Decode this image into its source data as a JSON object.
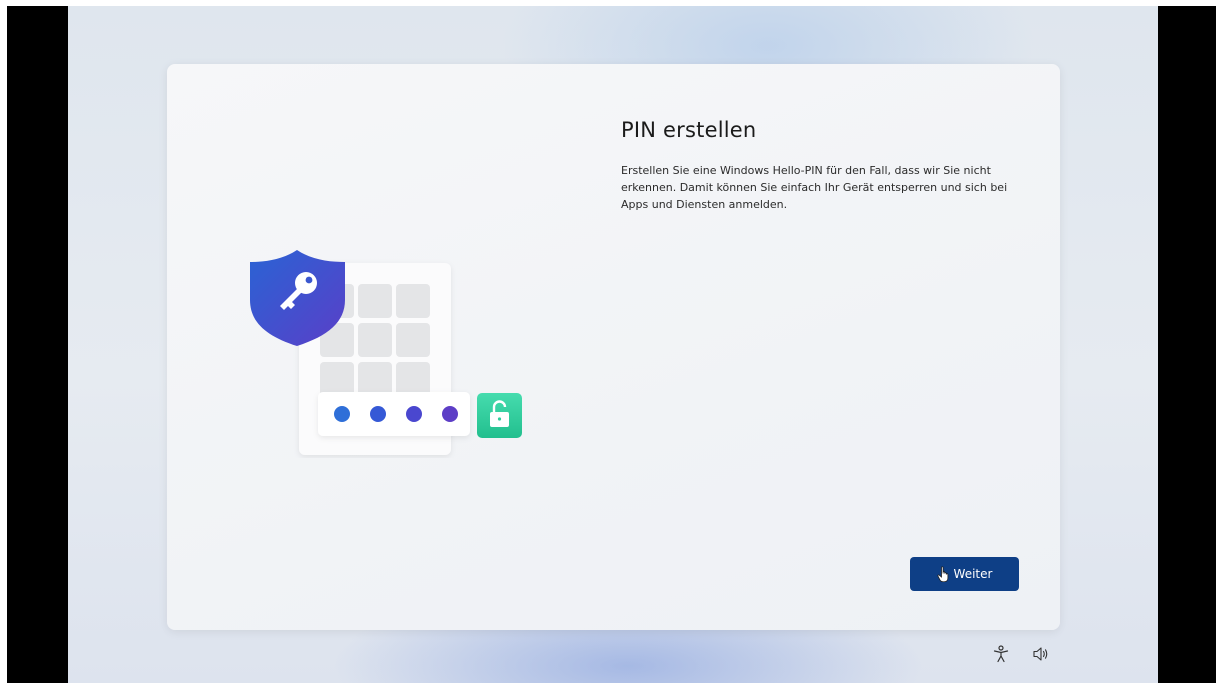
{
  "page": {
    "title": "PIN erstellen",
    "description": "Erstellen Sie eine Windows Hello-PIN für den Fall, dass wir Sie nicht erkennen. Damit können Sie einfach Ihr Gerät entsperren und sich bei Apps und Diensten anmelden."
  },
  "buttons": {
    "next_label": "Weiter"
  },
  "illustration": {
    "icons": [
      "shield-key-icon",
      "keypad-icon",
      "pin-dots-icon",
      "unlock-icon"
    ],
    "pin_dot_colors": [
      "#2f6fd8",
      "#3559d6",
      "#4a47cf",
      "#5d3ec6"
    ],
    "shield_color": "#2b52c8",
    "lock_color": "#2fcf9c"
  },
  "system_tray": {
    "icons": [
      "accessibility-icon",
      "volume-icon"
    ]
  },
  "colors": {
    "accent": "#0e3f86"
  }
}
